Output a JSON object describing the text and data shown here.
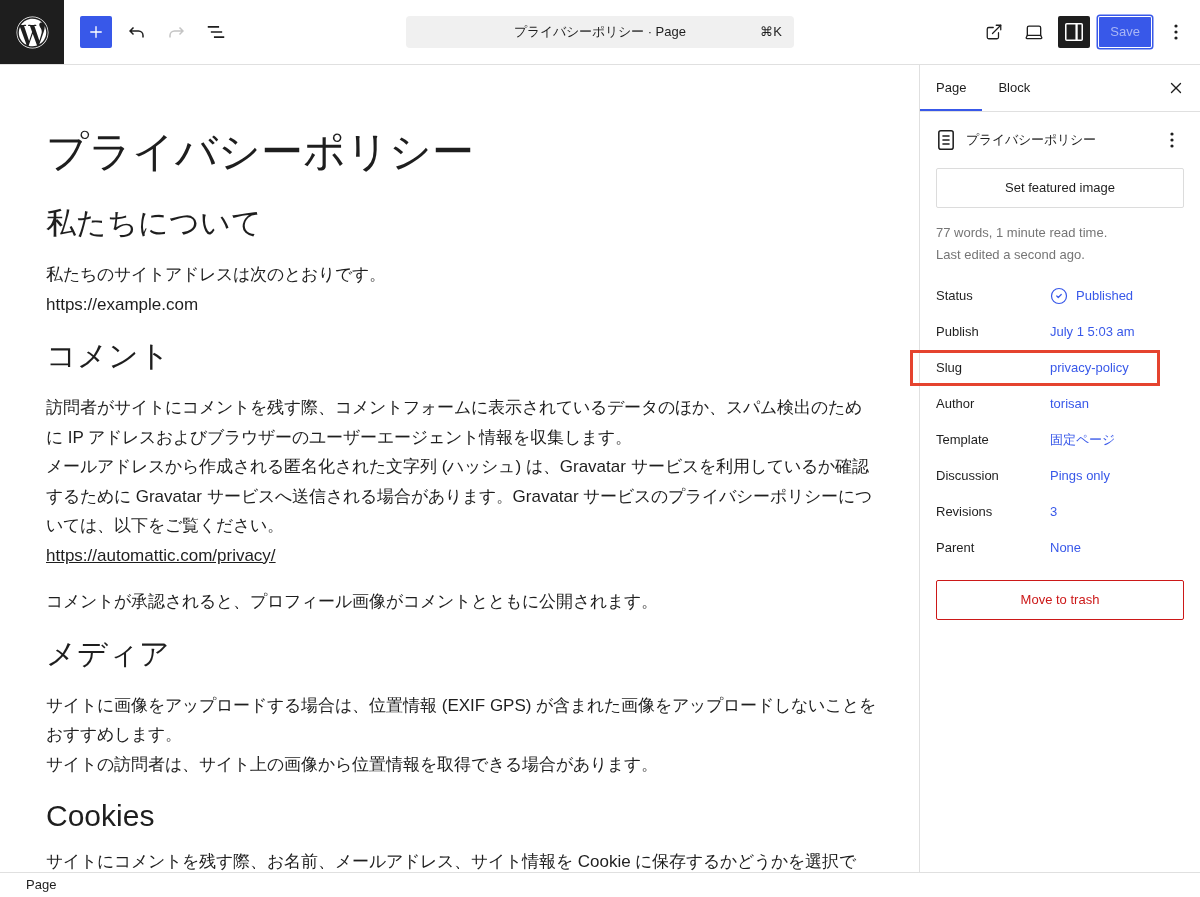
{
  "header": {
    "tools": [
      {
        "kind": "add",
        "disabled": false
      },
      {
        "kind": "undo",
        "disabled": false
      },
      {
        "kind": "redo",
        "disabled": true
      },
      {
        "kind": "list-view",
        "disabled": false
      }
    ],
    "command_bar": {
      "title": "プライバシーポリシー · Page",
      "shortcut": "⌘K"
    },
    "view_tools": [
      {
        "kind": "view",
        "pressed": false
      },
      {
        "kind": "preview",
        "pressed": false
      },
      {
        "kind": "settings",
        "pressed": true
      }
    ],
    "save_button": {
      "label": "Save",
      "disabled": true,
      "focused": true
    }
  },
  "editor": {
    "title": "プライバシーポリシー",
    "blocks": [
      {
        "kind": "heading",
        "text": "私たちについて"
      },
      {
        "kind": "paragraph",
        "lines": [
          {
            "text": "私たちのサイトアドレスは次のとおりです。",
            "link": false
          },
          {
            "text": "https://example.com",
            "link": false
          }
        ]
      },
      {
        "kind": "heading",
        "text": "コメント"
      },
      {
        "kind": "paragraph",
        "lines": [
          {
            "text": "訪問者がサイトにコメントを残す際、コメントフォームに表示されているデータのほか、スパム検出のために IP アドレスおよびブラウザーのユーザーエージェント情報を収集します。",
            "link": false
          },
          {
            "text": "メールアドレスから作成される匿名化された文字列 (ハッシュ) は、Gravatar サービスを利用しているか確認するために Gravatar サービスへ送信される場合があります。Gravatar サービスのプライバシーポリシーについては、以下をご覧ください。",
            "link": false
          },
          {
            "text": "https://automattic.com/privacy/",
            "link": true
          }
        ]
      },
      {
        "kind": "paragraph",
        "lines": [
          {
            "text": "コメントが承認されると、プロフィール画像がコメントとともに公開されます。",
            "link": false
          }
        ]
      },
      {
        "kind": "heading",
        "text": "メディア"
      },
      {
        "kind": "paragraph",
        "lines": [
          {
            "text": "サイトに画像をアップロードする場合は、位置情報 (EXIF GPS) が含まれた画像をアップロードしないことをおすすめします。",
            "link": false
          },
          {
            "text": "サイトの訪問者は、サイト上の画像から位置情報を取得できる場合があります。",
            "link": false
          }
        ]
      },
      {
        "kind": "heading",
        "text": "Cookies"
      },
      {
        "kind": "paragraph",
        "lines": [
          {
            "text": "サイトにコメントを残す際、お名前、メールアドレス、サイト情報を Cookie に保存するかどうかを選択で",
            "link": false
          }
        ]
      }
    ]
  },
  "sidebar": {
    "tabs": [
      {
        "label": "Page",
        "selected": true
      },
      {
        "label": "Block",
        "selected": false
      }
    ],
    "summary": {
      "title": "プライバシーポリシー"
    },
    "featured_image_button": "Set featured image",
    "stats": [
      "77 words, 1 minute read time.",
      "Last edited a second ago."
    ],
    "fields": [
      {
        "label": "Status",
        "value": "Published",
        "kind": "status",
        "highlighted": false
      },
      {
        "label": "Publish",
        "value": "July 1 5:03 am",
        "kind": "link",
        "highlighted": false
      },
      {
        "label": "Slug",
        "value": "privacy-policy",
        "kind": "link",
        "highlighted": true
      },
      {
        "label": "Author",
        "value": "torisan",
        "kind": "link",
        "highlighted": false
      },
      {
        "label": "Template",
        "value": "固定ページ",
        "kind": "link",
        "highlighted": false
      },
      {
        "label": "Discussion",
        "value": "Pings only",
        "kind": "link",
        "highlighted": false
      },
      {
        "label": "Revisions",
        "value": "3",
        "kind": "link",
        "highlighted": false
      },
      {
        "label": "Parent",
        "value": "None",
        "kind": "link",
        "highlighted": false
      }
    ],
    "trash_button": "Move to trash"
  },
  "status_bar": {
    "breadcrumb": "Page"
  }
}
